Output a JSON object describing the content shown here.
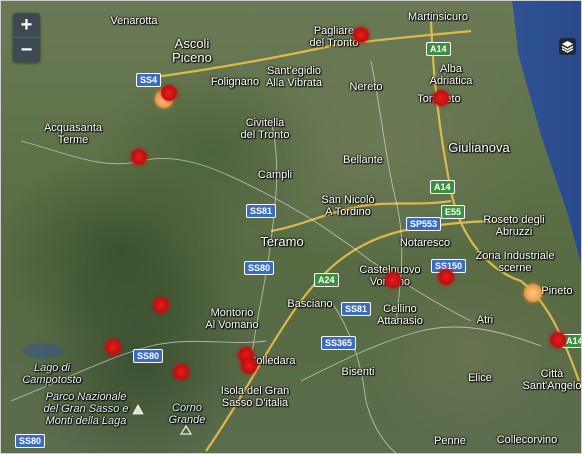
{
  "map": {
    "zoom_in": "+",
    "zoom_out": "−",
    "layers_icon": "layers-icon",
    "place_labels": [
      {
        "id": "venarotta",
        "text": "Venarotta"
      },
      {
        "id": "ascoli",
        "text": "Ascoli\nPiceno"
      },
      {
        "id": "folignano",
        "text": "Folignano"
      },
      {
        "id": "santegidio",
        "text": "Sant'egidio\nAlla Vibrata"
      },
      {
        "id": "pagliare",
        "text": "Pagliare\ndel Tronto"
      },
      {
        "id": "martinsicuro",
        "text": "Martinsicuro"
      },
      {
        "id": "alba",
        "text": "Alba\nAdriatica"
      },
      {
        "id": "nereto",
        "text": "Nereto"
      },
      {
        "id": "tortoreto",
        "text": "Tortoreto"
      },
      {
        "id": "acquasanta",
        "text": "Acquasanta\nTerme"
      },
      {
        "id": "civitella",
        "text": "Civitella\ndel Tronto"
      },
      {
        "id": "giulianova",
        "text": "Giulianova"
      },
      {
        "id": "bellante",
        "text": "Bellante"
      },
      {
        "id": "campli",
        "text": "Campli"
      },
      {
        "id": "sannicolo",
        "text": "San Nicolò\nA Tordino"
      },
      {
        "id": "roseto",
        "text": "Roseto degli\nAbruzzi"
      },
      {
        "id": "teramo",
        "text": "Teramo"
      },
      {
        "id": "notaresco",
        "text": "Notaresco"
      },
      {
        "id": "zona",
        "text": "Zona Industriale\nscerne"
      },
      {
        "id": "castelnuovo",
        "text": "Castelnuovo\nVomano"
      },
      {
        "id": "pineto",
        "text": "Pineto"
      },
      {
        "id": "montorio",
        "text": "Montorio\nAl Vomano"
      },
      {
        "id": "basciano",
        "text": "Basciano"
      },
      {
        "id": "cellino",
        "text": "Cellino\nAttanasio"
      },
      {
        "id": "atri",
        "text": "Atri"
      },
      {
        "id": "cortino",
        "text": "Colledara"
      },
      {
        "id": "lago",
        "text": "Lago di\nCampotosto"
      },
      {
        "id": "parco",
        "text": "Parco Nazionale\ndel Gran Sasso e\nMonti della Laga"
      },
      {
        "id": "isola",
        "text": "Isola del Gran\nSasso D'italia"
      },
      {
        "id": "bisenti",
        "text": "Bisenti"
      },
      {
        "id": "elice",
        "text": "Elice"
      },
      {
        "id": "cittasantangelo",
        "text": "Città\nSant'Angelo"
      },
      {
        "id": "corno",
        "text": "Corno\nGrande"
      },
      {
        "id": "penne",
        "text": "Penne"
      },
      {
        "id": "collecorvino",
        "text": "Collecorvino"
      }
    ],
    "road_shields": [
      {
        "id": "ss4",
        "text": "SS4",
        "kind": "blue"
      },
      {
        "id": "a14a",
        "text": "A14",
        "kind": "green"
      },
      {
        "id": "a14b",
        "text": "A14",
        "kind": "green"
      },
      {
        "id": "ss81a",
        "text": "SS81",
        "kind": "blue"
      },
      {
        "id": "sp553",
        "text": "SP553",
        "kind": "blue"
      },
      {
        "id": "e55",
        "text": "E55",
        "kind": "green"
      },
      {
        "id": "ss80a",
        "text": "SS80",
        "kind": "blue"
      },
      {
        "id": "a24",
        "text": "A24",
        "kind": "green"
      },
      {
        "id": "ss150",
        "text": "SS150",
        "kind": "blue"
      },
      {
        "id": "ss81b",
        "text": "SS81",
        "kind": "blue"
      },
      {
        "id": "ss365",
        "text": "SS365",
        "kind": "blue"
      },
      {
        "id": "ss80b",
        "text": "SS80",
        "kind": "blue"
      },
      {
        "id": "ss80c",
        "text": "SS80",
        "kind": "blue"
      },
      {
        "id": "a14c",
        "text": "A14",
        "kind": "green"
      }
    ],
    "markers": [
      {
        "id": "m1",
        "color": "red"
      },
      {
        "id": "m2",
        "color": "orange"
      },
      {
        "id": "m3",
        "color": "red"
      },
      {
        "id": "m4",
        "color": "red"
      },
      {
        "id": "m5",
        "color": "red"
      },
      {
        "id": "m6",
        "color": "red"
      },
      {
        "id": "m7",
        "color": "red"
      },
      {
        "id": "m8",
        "color": "red"
      },
      {
        "id": "m9",
        "color": "red"
      },
      {
        "id": "m10",
        "color": "red"
      },
      {
        "id": "m11",
        "color": "red"
      },
      {
        "id": "m12",
        "color": "orange"
      },
      {
        "id": "m13",
        "color": "red"
      }
    ]
  }
}
